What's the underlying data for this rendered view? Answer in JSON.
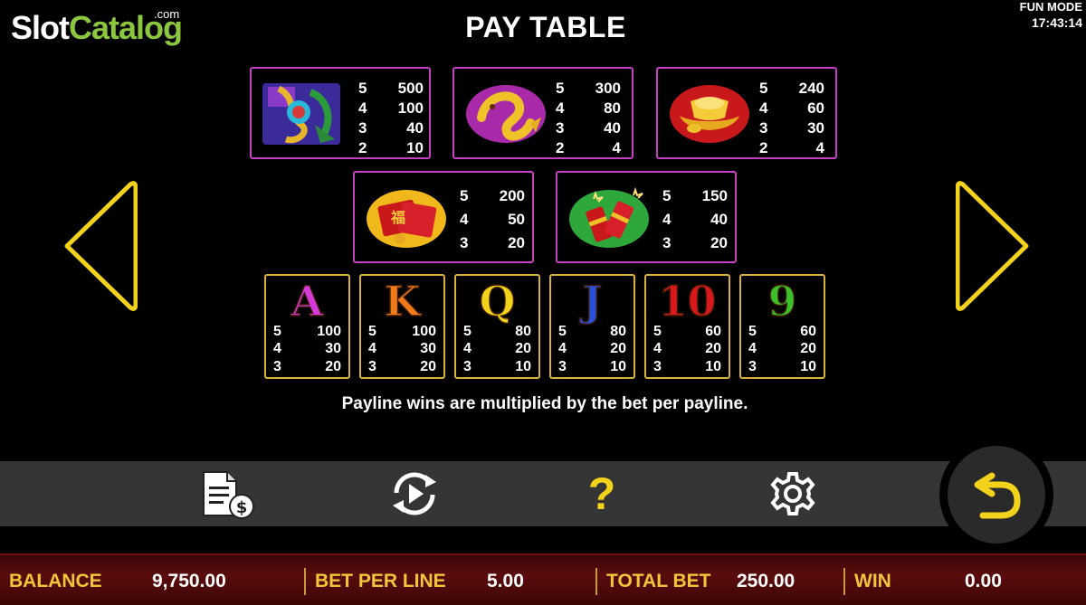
{
  "brand": {
    "name_part1": "Slot",
    "name_part2": "Catalog",
    "suffix": ".com"
  },
  "mode": {
    "label": "FUN MODE",
    "time": "17:43:14"
  },
  "title": "PAY TABLE",
  "premium_symbols": [
    {
      "icon": "dragon-phoenix-icon",
      "pays": [
        [
          "5",
          "500"
        ],
        [
          "4",
          "100"
        ],
        [
          "3",
          "40"
        ],
        [
          "2",
          "10"
        ]
      ]
    },
    {
      "icon": "golden-koi-icon",
      "pays": [
        [
          "5",
          "300"
        ],
        [
          "4",
          "80"
        ],
        [
          "3",
          "40"
        ],
        [
          "2",
          "4"
        ]
      ]
    },
    {
      "icon": "gold-ingot-icon",
      "pays": [
        [
          "5",
          "240"
        ],
        [
          "4",
          "60"
        ],
        [
          "3",
          "30"
        ],
        [
          "2",
          "4"
        ]
      ]
    },
    {
      "icon": "red-envelope-icon",
      "pays": [
        [
          "5",
          "200"
        ],
        [
          "4",
          "50"
        ],
        [
          "3",
          "20"
        ]
      ]
    },
    {
      "icon": "firecracker-icon",
      "pays": [
        [
          "5",
          "150"
        ],
        [
          "4",
          "40"
        ],
        [
          "3",
          "20"
        ]
      ]
    }
  ],
  "card_symbols": [
    {
      "letter": "A",
      "color": "#d53ad8",
      "pays": [
        [
          "5",
          "100"
        ],
        [
          "4",
          "30"
        ],
        [
          "3",
          "20"
        ]
      ]
    },
    {
      "letter": "K",
      "color": "#f07a1a",
      "pays": [
        [
          "5",
          "100"
        ],
        [
          "4",
          "30"
        ],
        [
          "3",
          "20"
        ]
      ]
    },
    {
      "letter": "Q",
      "color": "#f2d21a",
      "pays": [
        [
          "5",
          "80"
        ],
        [
          "4",
          "20"
        ],
        [
          "3",
          "10"
        ]
      ]
    },
    {
      "letter": "J",
      "color": "#2a4fd8",
      "pays": [
        [
          "5",
          "80"
        ],
        [
          "4",
          "20"
        ],
        [
          "3",
          "10"
        ]
      ]
    },
    {
      "letter": "10",
      "color": "#d8181c",
      "pays": [
        [
          "5",
          "60"
        ],
        [
          "4",
          "20"
        ],
        [
          "3",
          "10"
        ]
      ]
    },
    {
      "letter": "9",
      "color": "#3bbf2a",
      "pays": [
        [
          "5",
          "60"
        ],
        [
          "4",
          "20"
        ],
        [
          "3",
          "10"
        ]
      ]
    }
  ],
  "note": "Payline wins are multiplied by the bet per payline.",
  "toolbar": {
    "paytable_icon": "paytable-money-icon",
    "autoplay_icon": "autoplay-icon",
    "help_label": "?",
    "settings_icon": "gear-icon",
    "back_icon": "return-arrow-icon"
  },
  "status": {
    "balance_label": "BALANCE",
    "balance_value": "9,750.00",
    "bet_label": "BET PER LINE",
    "bet_value": "5.00",
    "total_label": "TOTAL BET",
    "total_value": "250.00",
    "win_label": "WIN",
    "win_value": "0.00"
  },
  "colors": {
    "accent_gold": "#f2c53a",
    "premium_border": "#c43fc4",
    "card_border": "#d9b23a",
    "arrow": "#f2d21a"
  }
}
